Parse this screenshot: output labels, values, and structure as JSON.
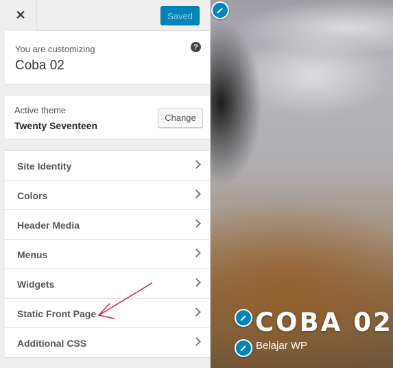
{
  "header": {
    "close_icon": "close-icon",
    "saved_label": "Saved"
  },
  "info": {
    "label": "You are customizing",
    "title": "Coba 02",
    "help_icon": "help-icon",
    "help_glyph": "?"
  },
  "theme": {
    "label": "Active theme",
    "name": "Twenty Seventeen",
    "change_label": "Change"
  },
  "sections": [
    {
      "label": "Site Identity"
    },
    {
      "label": "Colors"
    },
    {
      "label": "Header Media"
    },
    {
      "label": "Menus"
    },
    {
      "label": "Widgets"
    },
    {
      "label": "Static Front Page"
    },
    {
      "label": "Additional CSS"
    }
  ],
  "preview": {
    "site_title": "COBA 02",
    "tagline": "Belajar WP",
    "edit_icon": "pencil-icon"
  },
  "colors": {
    "accent": "#0085ba",
    "annotation_arrow": "#cc2244"
  }
}
